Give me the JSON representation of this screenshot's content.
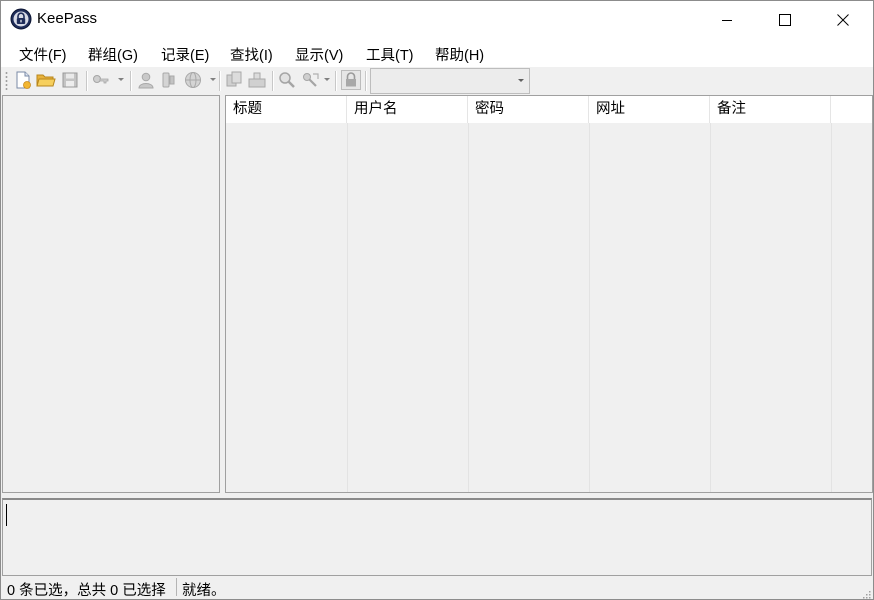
{
  "window": {
    "title": "KeePass",
    "icon": "keepass-lock-icon",
    "controls": [
      "minimize-icon",
      "maximize-icon",
      "close-icon"
    ]
  },
  "menu": {
    "items": [
      "文件(F)",
      "群组(G)",
      "记录(E)",
      "查找(I)",
      "显示(V)",
      "工具(T)",
      "帮助(H)"
    ]
  },
  "toolbar": {
    "buttons": [
      {
        "name": "new-database",
        "icon": "new-file-icon",
        "enabled": true
      },
      {
        "name": "open-database",
        "icon": "open-folder-icon",
        "enabled": true
      },
      {
        "name": "save-database",
        "icon": "save-disk-icon",
        "enabled": false
      },
      {
        "name": "add-entry",
        "icon": "key-add-icon",
        "enabled": false
      },
      {
        "name": "copy-username",
        "icon": "user-icon",
        "enabled": false
      },
      {
        "name": "copy-password",
        "icon": "key-icon",
        "enabled": false
      },
      {
        "name": "open-url",
        "icon": "globe-icon",
        "enabled": false
      },
      {
        "name": "perform-autotype",
        "icon": "copy-icon",
        "enabled": false
      },
      {
        "name": "autotype",
        "icon": "keyboard-icon",
        "enabled": false
      },
      {
        "name": "find",
        "icon": "magnifier-icon",
        "enabled": false
      },
      {
        "name": "show-entries",
        "icon": "key-arrow-icon",
        "enabled": false
      },
      {
        "name": "lock-workspace",
        "icon": "lock-icon",
        "enabled": false
      }
    ],
    "quick_find": {
      "value": "",
      "enabled": false
    }
  },
  "entry_list": {
    "columns": [
      "标题",
      "用户名",
      "密码",
      "网址",
      "备注"
    ],
    "rows": []
  },
  "statusbar": {
    "selection": "0 条已选，总共 0 已选择",
    "state": "就绪。"
  },
  "colors": {
    "chrome": "#f0f0f0",
    "titlebar": "#ffffff",
    "border": "#a0a0a0"
  }
}
